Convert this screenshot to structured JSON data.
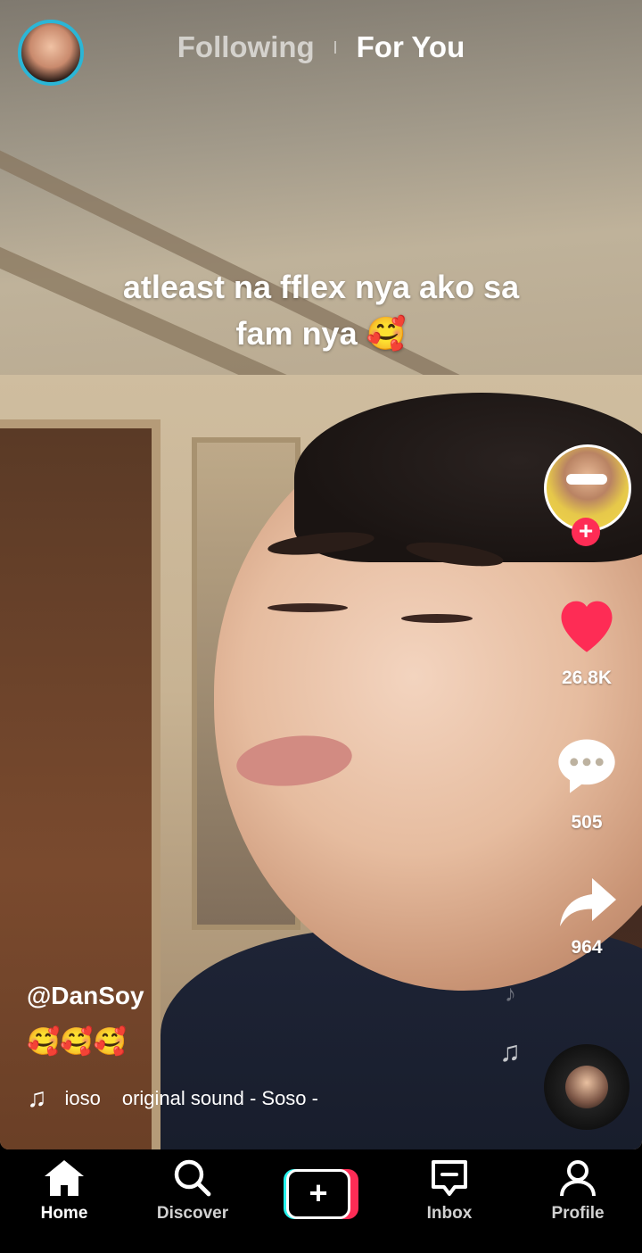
{
  "top": {
    "tabs": [
      "Following",
      "For You"
    ],
    "active_tab": "For You"
  },
  "video": {
    "caption_line1": "atleast na fflex nya ako sa",
    "caption_line2": "fam nya 🥰"
  },
  "rail": {
    "likes": "26.8K",
    "comments": "505",
    "shares": "964",
    "follow_symbol": "+"
  },
  "post": {
    "username": "@DanSoy",
    "description": "🥰🥰🥰",
    "music_prefix": "ioso",
    "music_title": "original sound - Soso -"
  },
  "nav": {
    "items": [
      "Home",
      "Discover",
      "Inbox",
      "Profile"
    ],
    "active": "Home",
    "create_symbol": "+"
  },
  "colors": {
    "accent": "#fe2c55",
    "avatar_ring": "#2bb6d6",
    "cyan": "#25f4ee"
  }
}
